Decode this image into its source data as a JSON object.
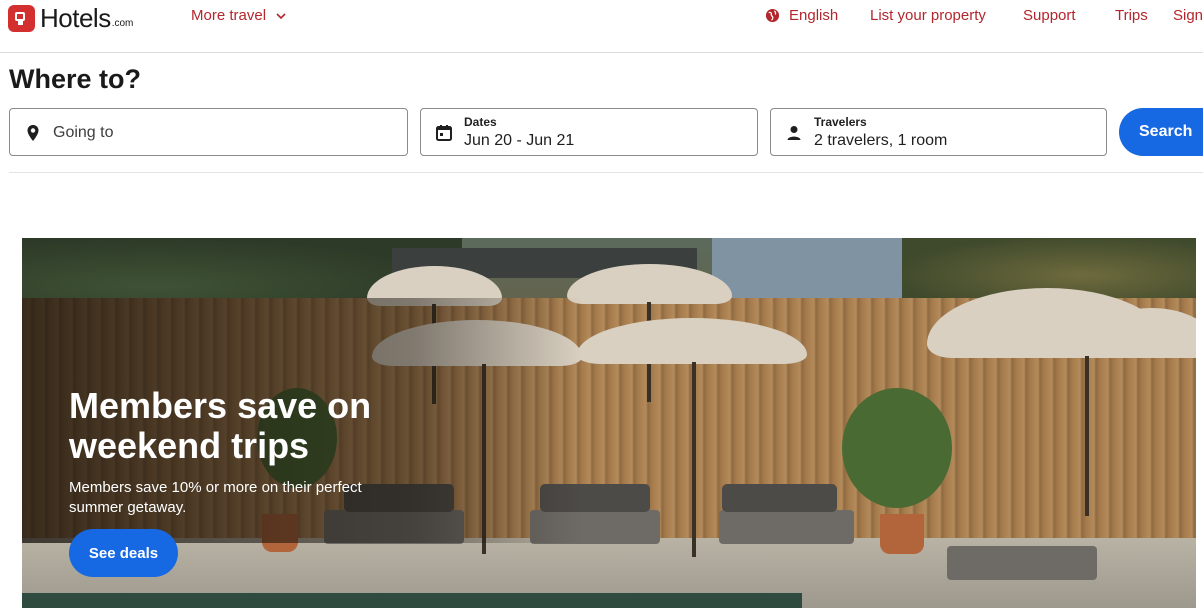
{
  "header": {
    "logo_text": "Hotels",
    "logo_sub": ".com",
    "more_travel": "More travel",
    "language": "English",
    "list_property": "List your property",
    "support": "Support",
    "trips": "Trips",
    "sign_in": "Sign"
  },
  "search": {
    "title": "Where to?",
    "going_to_placeholder": "Going to",
    "dates_label": "Dates",
    "dates_value": "Jun 20 - Jun 21",
    "travelers_label": "Travelers",
    "travelers_value": "2 travelers, 1 room",
    "search_button": "Search"
  },
  "hero": {
    "title": "Members save on weekend trips",
    "subtitle": "Members save 10% or more on their perfect summer getaway.",
    "cta": "See deals"
  },
  "colors": {
    "brand_red": "#d32f2f",
    "nav_red": "#b3262d",
    "primary_blue": "#1668e3"
  },
  "icons": {
    "logo": "hotels-logo-icon",
    "more_travel": "chevron-down-icon",
    "language": "globe-icon",
    "going_to": "map-pin-icon",
    "dates": "calendar-icon",
    "travelers": "person-icon"
  }
}
